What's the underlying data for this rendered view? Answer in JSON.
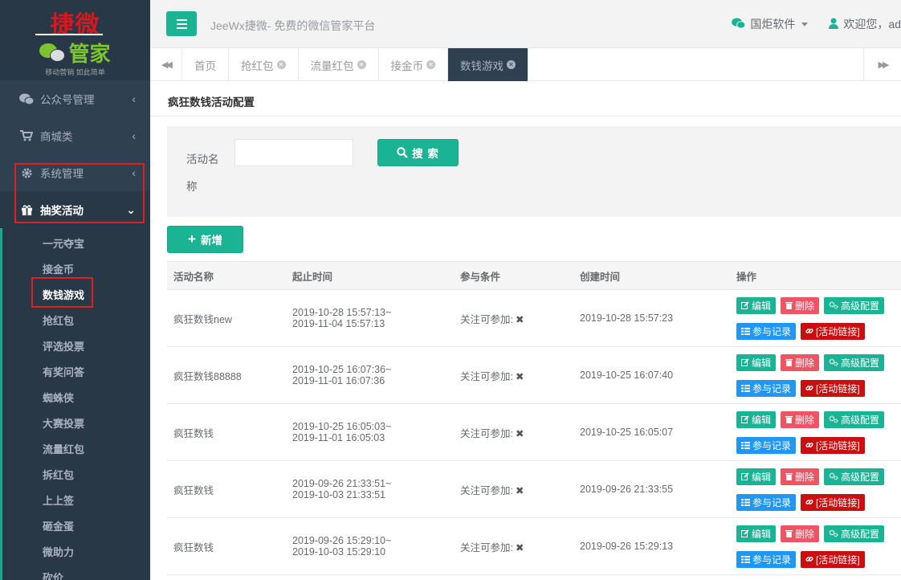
{
  "logo": {
    "top_text": "捷微",
    "mid_text": "管家",
    "sub_text": "移动营销 如此简单"
  },
  "sidebar": {
    "items": [
      {
        "label": "公众号管理",
        "icon": "wechat-icon"
      },
      {
        "label": "商城类",
        "icon": "cart-icon"
      },
      {
        "label": "系统管理",
        "icon": "gear-icon"
      },
      {
        "label": "抽奖活动",
        "icon": "gift-icon"
      }
    ],
    "submenu": [
      "一元夺宝",
      "接金币",
      "数钱游戏",
      "抢红包",
      "评选投票",
      "有奖问答",
      "蜘蛛侠",
      "大赛投票",
      "流量红包",
      "拆红包",
      "上上签",
      "砸金蛋",
      "微助力",
      "砍价"
    ]
  },
  "header": {
    "title": "JeeWx捷微- 免费的微信管家平台",
    "company": "国炬软件",
    "welcome": "欢迎您，ad"
  },
  "tabs": [
    {
      "label": "首页"
    },
    {
      "label": "抢红包"
    },
    {
      "label": "流量红包"
    },
    {
      "label": "接金币"
    },
    {
      "label": "数钱游戏"
    }
  ],
  "panel": {
    "title": "疯狂数钱活动配置"
  },
  "search": {
    "label": "活动名称",
    "value": "",
    "button": "搜 索"
  },
  "add_button": "新增",
  "table": {
    "headers": [
      "活动名称",
      "起止时间",
      "参与条件",
      "创建时间",
      "操作"
    ],
    "rows": [
      {
        "name": "疯狂数钱new",
        "start": "2019-10-28 15:57:13~",
        "end": "2019-11-04 15:57:13",
        "cond": "关注可参加:",
        "created": "2019-10-28 15:57:23"
      },
      {
        "name": "疯狂数钱88888",
        "start": "2019-10-25 16:07:36~",
        "end": "2019-11-01 16:07:36",
        "cond": "关注可参加:",
        "created": "2019-10-25 16:07:40"
      },
      {
        "name": "疯狂数钱",
        "start": "2019-10-25 16:05:03~",
        "end": "2019-11-01 16:05:03",
        "cond": "关注可参加:",
        "created": "2019-10-25 16:05:07"
      },
      {
        "name": "疯狂数钱",
        "start": "2019-09-26 21:33:51~",
        "end": "2019-10-03 21:33:51",
        "cond": "关注可参加:",
        "created": "2019-09-26 21:33:55"
      },
      {
        "name": "疯狂数钱",
        "start": "2019-09-26 15:29:10~",
        "end": "2019-10-03 15:29:10",
        "cond": "关注可参加:",
        "created": "2019-09-26 15:29:13"
      }
    ],
    "ops": {
      "edit": "编辑",
      "delete": "删除",
      "config": "高级配置",
      "records": "参与记录",
      "link": "[活动链接]"
    }
  },
  "colors": {
    "primary": "#1ab394",
    "sidebar": "#2f4050",
    "danger": "#ed5565",
    "info": "#2196f3",
    "link_red": "#c90f0f",
    "highlight_box": "#e02020"
  }
}
